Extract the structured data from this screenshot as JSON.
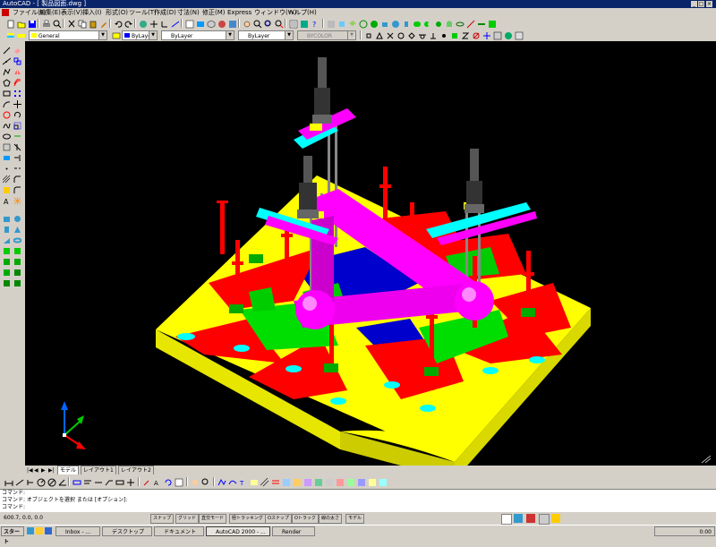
{
  "window": {
    "title": "AutoCAD - [ 製品図面.dwg ]",
    "controls": [
      "minimize-icon",
      "restore-icon",
      "close-icon"
    ]
  },
  "menu": {
    "items": [
      "ファイル(F)",
      "編集(E)",
      "表示(V)",
      "挿入(I)",
      "形式(O)",
      "ツール(T)",
      "作成(D)",
      "寸法(N)",
      "修正(M)",
      "Express",
      "ウィンドウ(W)",
      "ヘルプ(H)"
    ]
  },
  "layer_toolbar": {
    "layer_value": "General",
    "color_value": "ByLayer",
    "linetype_value": "ByLayer",
    "lineweight_value": "ByLayer",
    "plotstyle_value": "BYCOLOR"
  },
  "layout_tabs": {
    "items": [
      "モデル",
      "レイアウト1",
      "レイアウト2"
    ],
    "active_index": 0
  },
  "command_line": {
    "lines": [
      "コマンド:",
      "コマンド: オブジェクトを選択 または [オプション]:",
      "コマンド:"
    ]
  },
  "status_bar": {
    "coordinates": "600.7, 0.0, 0.0",
    "modes": [
      "スナップ",
      "グリッド",
      "直交モード",
      "極トラッキング",
      "Oスナップ",
      "Oトラック",
      "線の太さ",
      "モデル"
    ]
  },
  "taskbar": {
    "start_label": "スタート",
    "tasks": [
      "Inbox - ...",
      "デスクトップ",
      "ドキュメント",
      "AutoCAD 2000 - ...",
      "Render"
    ],
    "active_index": 3,
    "clock": "0:00"
  },
  "colors": {
    "title_bar": "#0a246a",
    "chrome": "#d4d0c8",
    "canvas_bg": "#000000",
    "model_base": "#ffff00",
    "model_red": "#ff0000",
    "model_green": "#00dd00",
    "model_magenta": "#ff00ff",
    "model_cyan": "#00ffff",
    "model_blue": "#0000cc",
    "model_gray": "#666666"
  }
}
